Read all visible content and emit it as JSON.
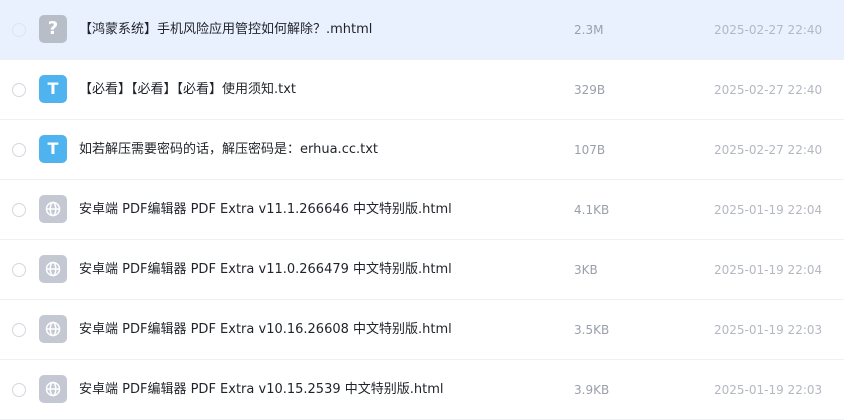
{
  "files": [
    {
      "name": "【鸿蒙系统】手机风险应用管控如何解除？.mhtml",
      "size": "2.3M",
      "date": "2025-02-27 22:40",
      "icon": "unknown-file-icon",
      "glyph": "?"
    },
    {
      "name": "【必看】【必看】【必看】使用须知.txt",
      "size": "329B",
      "date": "2025-02-27 22:40",
      "icon": "text-file-icon",
      "glyph": "T"
    },
    {
      "name": "如若解压需要密码的话，解压密码是：erhua.cc.txt",
      "size": "107B",
      "date": "2025-02-27 22:40",
      "icon": "text-file-icon",
      "glyph": "T"
    },
    {
      "name": "安卓端 PDF编辑器 PDF Extra v11.1.266646 中文特别版.html",
      "size": "4.1KB",
      "date": "2025-01-19 22:04",
      "icon": "web-file-icon",
      "glyph": ""
    },
    {
      "name": "安卓端 PDF编辑器 PDF Extra v11.0.266479 中文特别版.html",
      "size": "3KB",
      "date": "2025-01-19 22:04",
      "icon": "web-file-icon",
      "glyph": ""
    },
    {
      "name": "安卓端 PDF编辑器 PDF Extra v10.16.26608 中文特别版.html",
      "size": "3.5KB",
      "date": "2025-01-19 22:03",
      "icon": "web-file-icon",
      "glyph": ""
    },
    {
      "name": "安卓端 PDF编辑器 PDF Extra v10.15.2539 中文特别版.html",
      "size": "3.9KB",
      "date": "2025-01-19 22:03",
      "icon": "web-file-icon",
      "glyph": ""
    }
  ],
  "colors": {
    "selected_row": "#eaf1fe",
    "text_icon": "#4fb3ef",
    "unknown_icon": "#b8bec8",
    "web_icon": "#c3c8d3"
  }
}
